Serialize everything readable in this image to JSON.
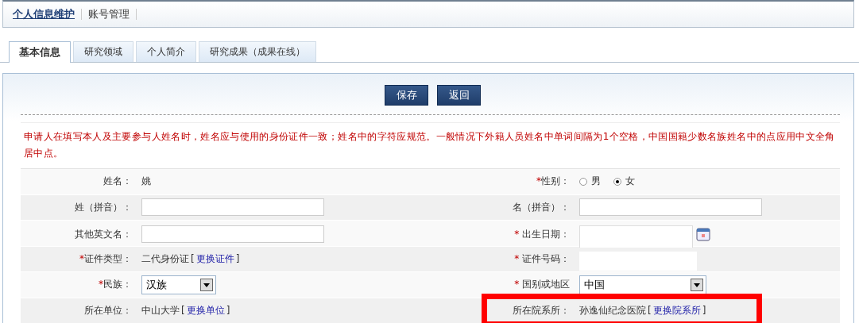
{
  "top_nav": [
    {
      "label": "个人信息维护",
      "selected": true
    },
    {
      "label": "账号管理",
      "selected": false
    }
  ],
  "tabs": [
    {
      "label": "基本信息",
      "selected": true
    },
    {
      "label": "研究领域",
      "selected": false
    },
    {
      "label": "个人简介",
      "selected": false
    },
    {
      "label": "研究成果（成果在线）",
      "selected": false
    }
  ],
  "buttons": [
    "保存",
    "返回"
  ],
  "notice": "申请人在填写本人及主要参与人姓名时，姓名应与使用的身份证件一致；姓名中的字符应规范。一般情况下外籍人员姓名中单词间隔为1个空格，中国国籍少数名族姓名中的点应用中文全角居中点。",
  "rows": [
    {
      "left": {
        "kind": "text",
        "label": "姓名：",
        "value": "姚"
      },
      "right": {
        "kind": "radio",
        "marker": "*",
        "label": "性别：",
        "options": [
          {
            "label": "男",
            "selected": false
          },
          {
            "label": "女",
            "selected": true
          }
        ]
      }
    },
    {
      "left": {
        "kind": "input",
        "label": "姓（拼音）："
      },
      "right": {
        "kind": "input",
        "label": "名（拼音）："
      }
    },
    {
      "left": {
        "kind": "input",
        "label": "其他英文名："
      },
      "right": {
        "kind": "date",
        "marker": "* ",
        "label": "出生日期："
      }
    },
    {
      "left": {
        "kind": "link",
        "marker": "*",
        "label": "证件类型：",
        "value": "二代身份证",
        "open": "[",
        "link": "更换证件",
        "close": "]"
      },
      "right": {
        "kind": "masked",
        "marker": "* ",
        "label": "证件号码："
      }
    },
    {
      "left": {
        "kind": "select",
        "marker": "*",
        "label": "民族：",
        "value": "汉族"
      },
      "right": {
        "kind": "select",
        "marker": "* ",
        "label": "国别或地区",
        "value": "中国"
      }
    },
    {
      "left": {
        "kind": "link",
        "label": "所在单位：",
        "value": "中山大学",
        "open": "[",
        "link": "更换单位",
        "close": "]"
      },
      "right": {
        "kind": "link",
        "label": "所在院系所：",
        "value": "孙逸仙纪念医院",
        "open": "[",
        "link": "更换院系所",
        "close": "]",
        "highlighted": true
      }
    },
    {
      "left": {
        "kind": "empty"
      },
      "right": {
        "kind": "empty"
      }
    }
  ]
}
